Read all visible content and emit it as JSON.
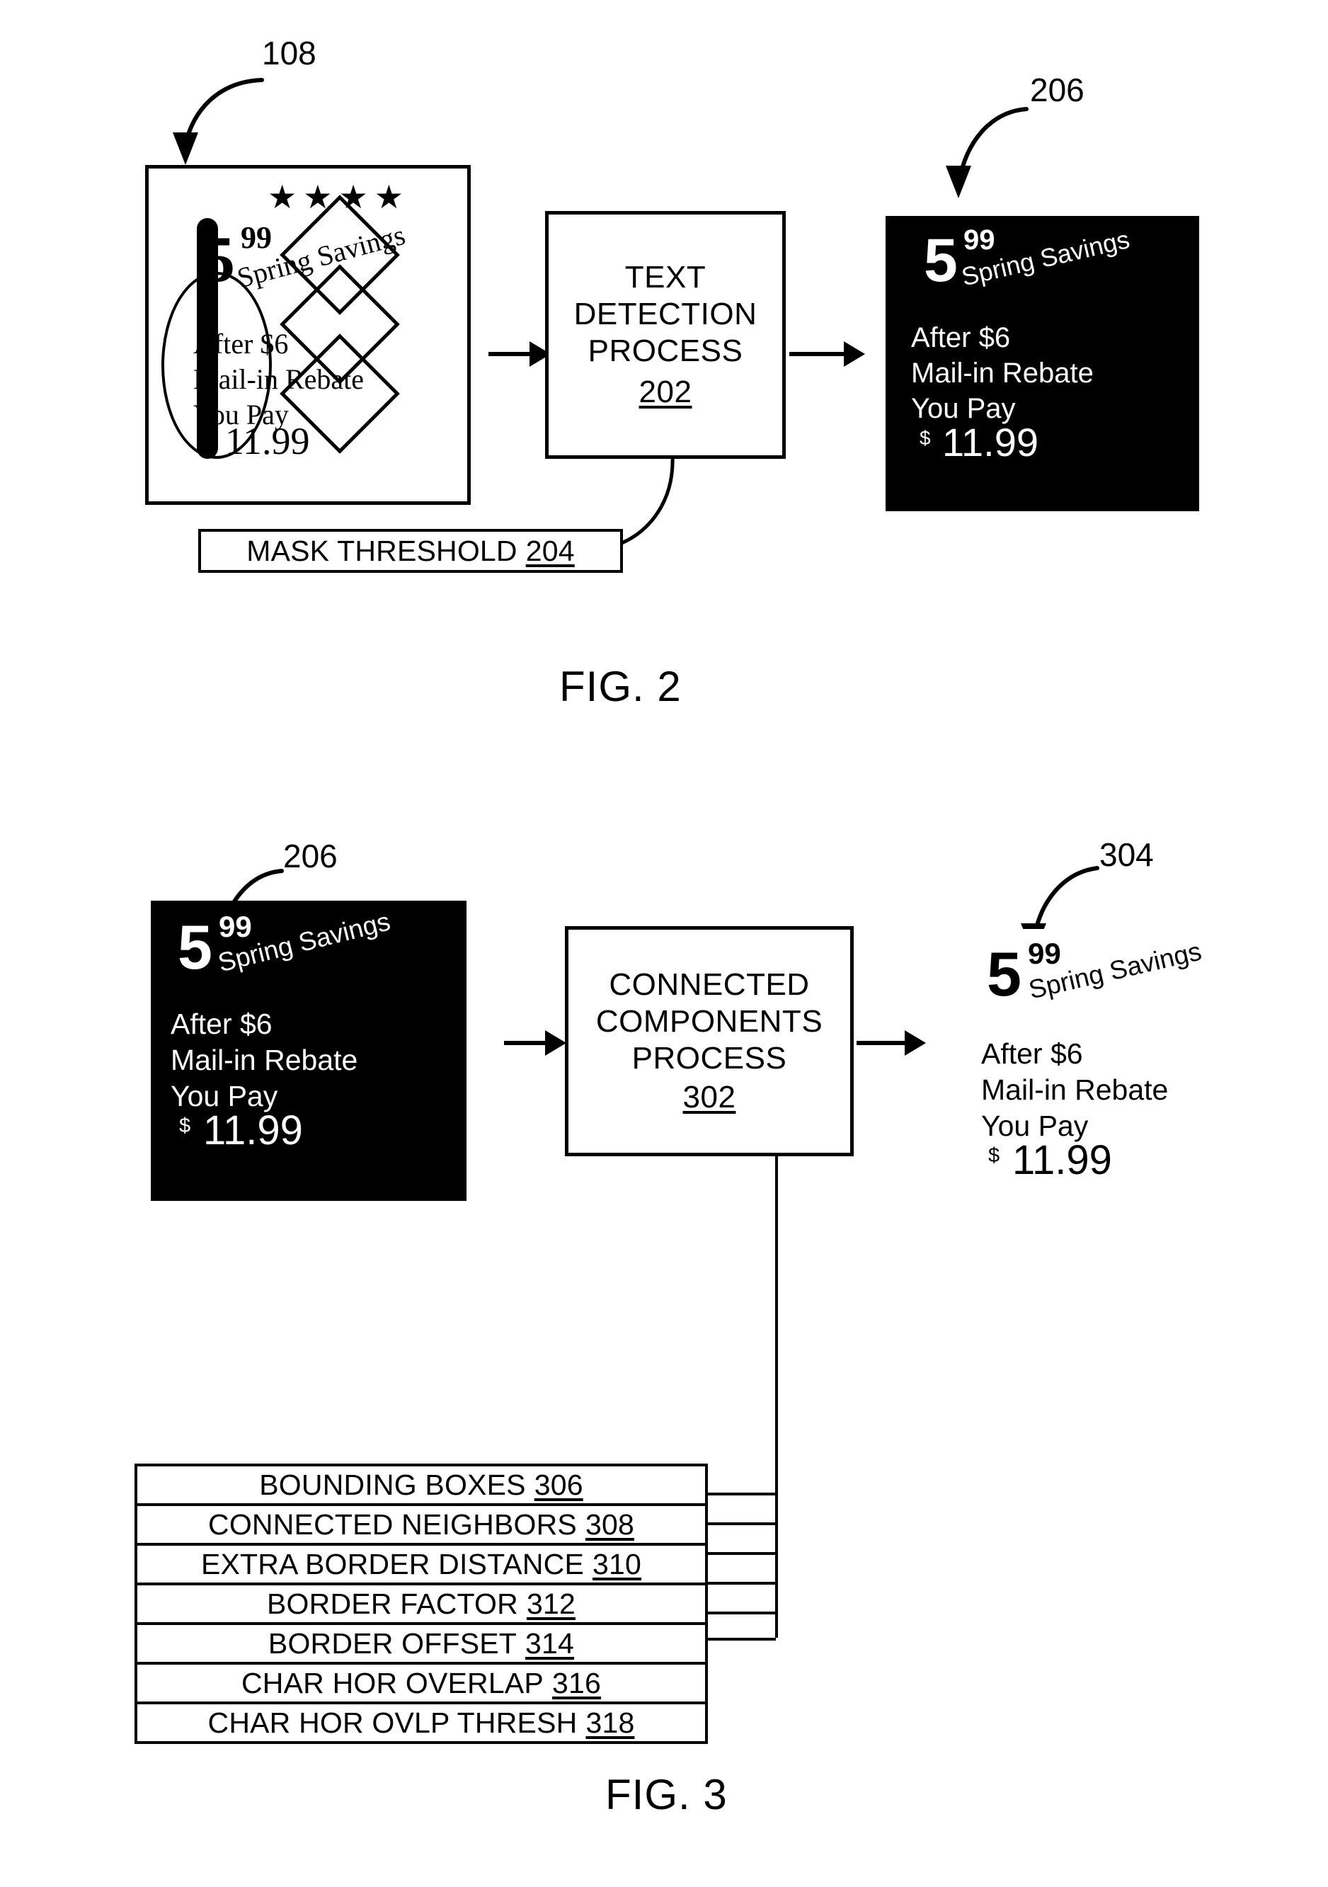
{
  "figures": [
    {
      "caption": "FIG. 2",
      "reference_labels": [
        {
          "name": "input-image-ref",
          "value": "108"
        },
        {
          "name": "masked-image-ref",
          "value": "206"
        }
      ],
      "process": {
        "lines": [
          "TEXT",
          "DETECTION",
          "PROCESS"
        ],
        "ref": "202"
      },
      "parameter": {
        "label": "MASK THRESHOLD",
        "ref": "204"
      }
    },
    {
      "caption": "FIG. 3",
      "reference_labels": [
        {
          "name": "masked-image-ref",
          "value": "206"
        },
        {
          "name": "components-image-ref",
          "value": "304"
        }
      ],
      "process": {
        "lines": [
          "CONNECTED",
          "COMPONENTS",
          "PROCESS"
        ],
        "ref": "302"
      },
      "parameters": [
        {
          "label": "BOUNDING BOXES",
          "ref": "306"
        },
        {
          "label": "CONNECTED NEIGHBORS",
          "ref": "308"
        },
        {
          "label": "EXTRA BORDER DISTANCE",
          "ref": "310"
        },
        {
          "label": "BORDER FACTOR",
          "ref": "312"
        },
        {
          "label": "BORDER OFFSET",
          "ref": "314"
        },
        {
          "label": "CHAR HOR OVERLAP",
          "ref": "316"
        },
        {
          "label": "CHAR HOR OVLP THRESH",
          "ref": "318"
        }
      ]
    }
  ],
  "advertisement": {
    "stars": "★★★★",
    "price_main": "5",
    "price_cents": "99",
    "promo": "Spring Savings",
    "line_after": "After $6",
    "line_rebate": "Mail-in Rebate",
    "line_youpay": "You Pay",
    "currency": "$",
    "final_price": "11.99"
  },
  "colors": {
    "ink": "#000000",
    "paper": "#ffffff",
    "masked_background": "#000000",
    "masked_text": "#ffffff"
  }
}
